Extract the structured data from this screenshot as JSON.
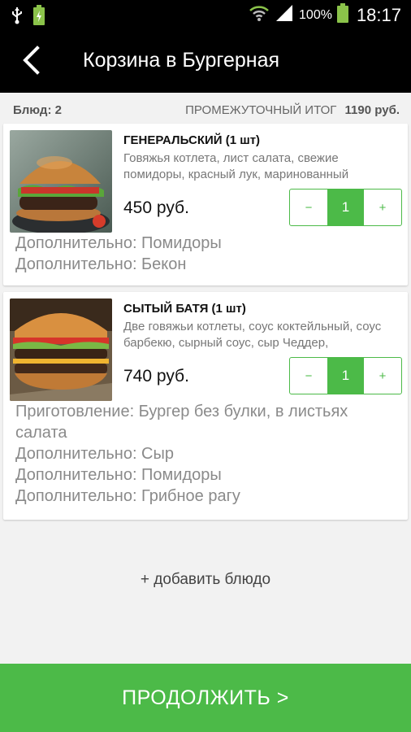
{
  "status_bar": {
    "battery_percent": "100%",
    "time": "18:17",
    "icons": [
      "usb-icon",
      "battery-charging-icon",
      "wifi-icon",
      "signal-icon",
      "battery-icon"
    ]
  },
  "app_bar": {
    "title": "Корзина в Бургерная",
    "back_icon": "back-arrow-icon"
  },
  "summary": {
    "count_label": "Блюд: 2",
    "subtotal_label": "ПРОМЕЖУТОЧНЫЙ ИТОГ",
    "subtotal_value": "1190 руб."
  },
  "items": [
    {
      "name": "ГЕНЕРАЛЬСКИЙ (1 шт)",
      "description": "Говяжья котлета, лист салата, свежие помидоры, красный лук, маринованный",
      "price": "450 руб.",
      "quantity": "1",
      "minus": "−",
      "plus": "+",
      "modifiers": [
        "Дополнительно: Помидоры",
        "Дополнительно: Бекон"
      ]
    },
    {
      "name": "СЫТЫЙ БАТЯ (1 шт)",
      "description": "Две говяжьи котлеты, соус коктейльный, соус барбекю, сырный соус, сыр Чеддер,",
      "price": "740 руб.",
      "quantity": "1",
      "minus": "−",
      "plus": "+",
      "modifiers": [
        "Приготовление: Бургер без булки, в листьях салата",
        "Дополнительно: Сыр",
        "Дополнительно: Помидоры",
        "Дополнительно: Грибное рагу"
      ]
    }
  ],
  "add_dish_label": "+ добавить блюдо",
  "continue_label": "ПРОДОЛЖИТЬ >",
  "colors": {
    "accent": "#4cba48",
    "appbar": "#000000",
    "background": "#f2f2f2"
  }
}
